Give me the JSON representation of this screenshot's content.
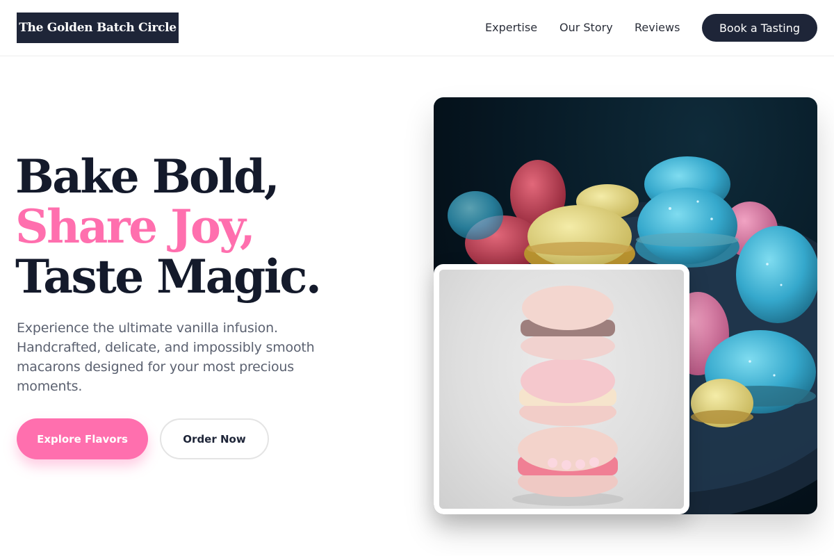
{
  "header": {
    "logo_text": "The Golden Batch Circle",
    "nav": [
      {
        "label": "Expertise"
      },
      {
        "label": "Our Story"
      },
      {
        "label": "Reviews"
      }
    ],
    "cta_label": "Book a Tasting"
  },
  "hero": {
    "headline_line1": "Bake Bold,",
    "headline_line2": "Share Joy,",
    "headline_line3": "Taste Magic.",
    "description": "Experience the ultimate vanilla infusion. Handcrafted, delicate, and impossibly smooth macarons designed for your most precious moments.",
    "primary_button": "Explore Flavors",
    "secondary_button": "Order Now"
  },
  "colors": {
    "accent": "#ff6fae",
    "navy": "#1e2538",
    "text_dark": "#141a2b",
    "text_muted": "#5b6170"
  },
  "images": {
    "main": "macaron-assortment-photo",
    "overlay": "stacked-pink-macarons-photo"
  }
}
